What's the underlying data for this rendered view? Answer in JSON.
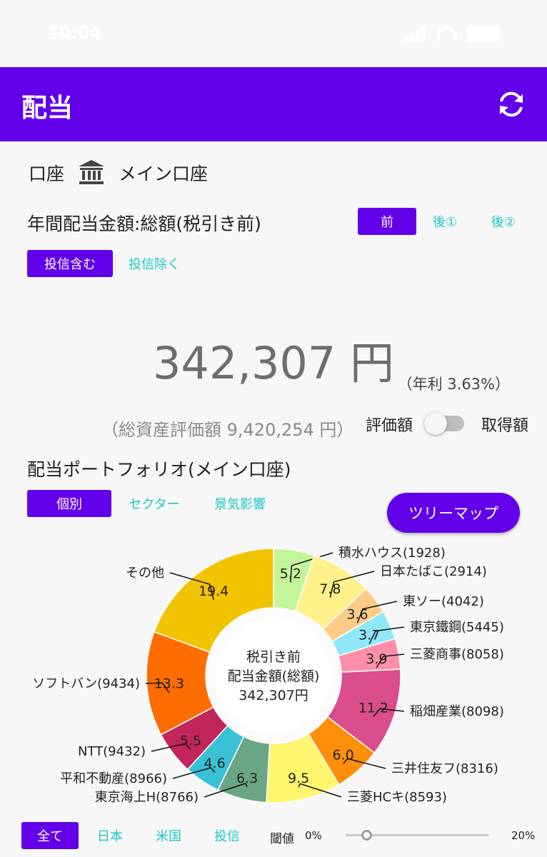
{
  "status_bar": {
    "time": "10:04"
  },
  "app_bar": {
    "title": "配当",
    "refresh_icon": "refresh-icon"
  },
  "account": {
    "label": "口座",
    "icon": "bank-icon",
    "name": "メイン口座"
  },
  "annual": {
    "label": "年間配当金額:総額(税引き前)",
    "tax_options": [
      "前",
      "後①",
      "後②"
    ],
    "tax_selected": "前",
    "fund_options": [
      "投信含む",
      "投信除く"
    ],
    "fund_selected": "投信含む"
  },
  "summary": {
    "amount": "342,307 円",
    "yield": "（年利 3.63%）",
    "total_assets": "（総資産評価額 9,420,254 円）",
    "toggle_left": "評価額",
    "toggle_right": "取得額",
    "toggle_on": false
  },
  "portfolio": {
    "title": "配当ポートフォリオ(メイン口座)",
    "view_options": [
      "個別",
      "セクター",
      "景気影響"
    ],
    "view_selected": "個別",
    "treemap_button": "ツリーマップ"
  },
  "chart_data": {
    "type": "pie",
    "center_text": [
      "税引き前",
      "配当金額(総額)",
      "342,307円"
    ],
    "slices": [
      {
        "label": "積水ハウス(1928)",
        "value": 5.2,
        "color": "#c4f59a"
      },
      {
        "label": "日本たばこ(2914)",
        "value": 7.8,
        "color": "#fff08a"
      },
      {
        "label": "東ソー(4042)",
        "value": 3.6,
        "color": "#ffcc88"
      },
      {
        "label": "東京鐵鋼(5445)",
        "value": 3.7,
        "color": "#8ee8f7"
      },
      {
        "label": "三菱商事(8058)",
        "value": 3.9,
        "color": "#ff8fa8"
      },
      {
        "label": "稲畑産業(8098)",
        "value": 11.2,
        "color": "#d94e8b"
      },
      {
        "label": "三井住友フ(8316)",
        "value": 6.0,
        "color": "#ff8f0a"
      },
      {
        "label": "三菱HCキ(8593)",
        "value": 9.5,
        "color": "#fff56e"
      },
      {
        "label": "東京海上H(8766)",
        "value": 6.3,
        "color": "#6aa684"
      },
      {
        "label": "平和不動産(8966)",
        "value": 4.6,
        "color": "#3ac1d6"
      },
      {
        "label": "NTT(9432)",
        "value": 5.5,
        "color": "#c2255c"
      },
      {
        "label": "ソフトバン(9434)",
        "value": 13.3,
        "color": "#ff6d00"
      },
      {
        "label": "その他",
        "value": 19.4,
        "color": "#f2c300"
      }
    ]
  },
  "filter": {
    "options": [
      "全て",
      "日本",
      "米国",
      "投信"
    ],
    "selected": "全て",
    "threshold_label": "閾値",
    "min_label": "0%",
    "max_label": "20%",
    "threshold_value": 0.15
  }
}
